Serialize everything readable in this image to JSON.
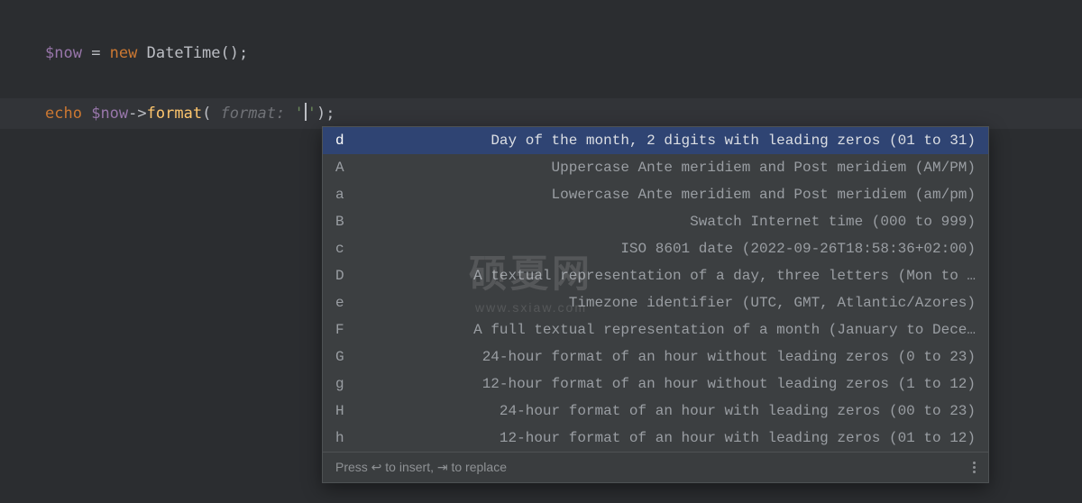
{
  "code": {
    "var1": "$now",
    "op_assign": " = ",
    "kw_new": "new",
    "space": " ",
    "type": "DateTime",
    "paren_empty": "()",
    "semi": ";",
    "echo": "echo",
    "arrow": "->",
    "method": "format",
    "paren_open": "(",
    "hint_label": " format: ",
    "str_open": "'",
    "str_close": "'",
    "paren_close": ")",
    "semi2": ";"
  },
  "completion": {
    "items": [
      {
        "key": "d",
        "desc": "Day of the month, 2 digits with leading zeros (01 to 31)"
      },
      {
        "key": "A",
        "desc": "Uppercase Ante meridiem and Post meridiem (AM/PM)"
      },
      {
        "key": "a",
        "desc": "Lowercase Ante meridiem and Post meridiem (am/pm)"
      },
      {
        "key": "B",
        "desc": "Swatch Internet time (000 to 999)"
      },
      {
        "key": "c",
        "desc": "ISO 8601 date (2022-09-26T18:58:36+02:00)"
      },
      {
        "key": "D",
        "desc": "A textual representation of a day, three letters (Mon to …"
      },
      {
        "key": "e",
        "desc": "Timezone identifier (UTC, GMT, Atlantic/Azores)"
      },
      {
        "key": "F",
        "desc": "A full textual representation of a month (January to Dece…"
      },
      {
        "key": "G",
        "desc": "24-hour format of an hour without leading zeros (0 to 23)"
      },
      {
        "key": "g",
        "desc": "12-hour format of an hour without leading zeros (1 to 12)"
      },
      {
        "key": "H",
        "desc": "24-hour format of an hour with leading zeros (00 to 23)"
      },
      {
        "key": "h",
        "desc": "12-hour format of an hour with leading zeros (01 to 12)"
      }
    ],
    "selected_index": 0,
    "footer": "Press ↩ to insert, ⇥ to replace"
  },
  "watermark": {
    "big": "硕夏网",
    "small": "www.sxiaw.com"
  }
}
